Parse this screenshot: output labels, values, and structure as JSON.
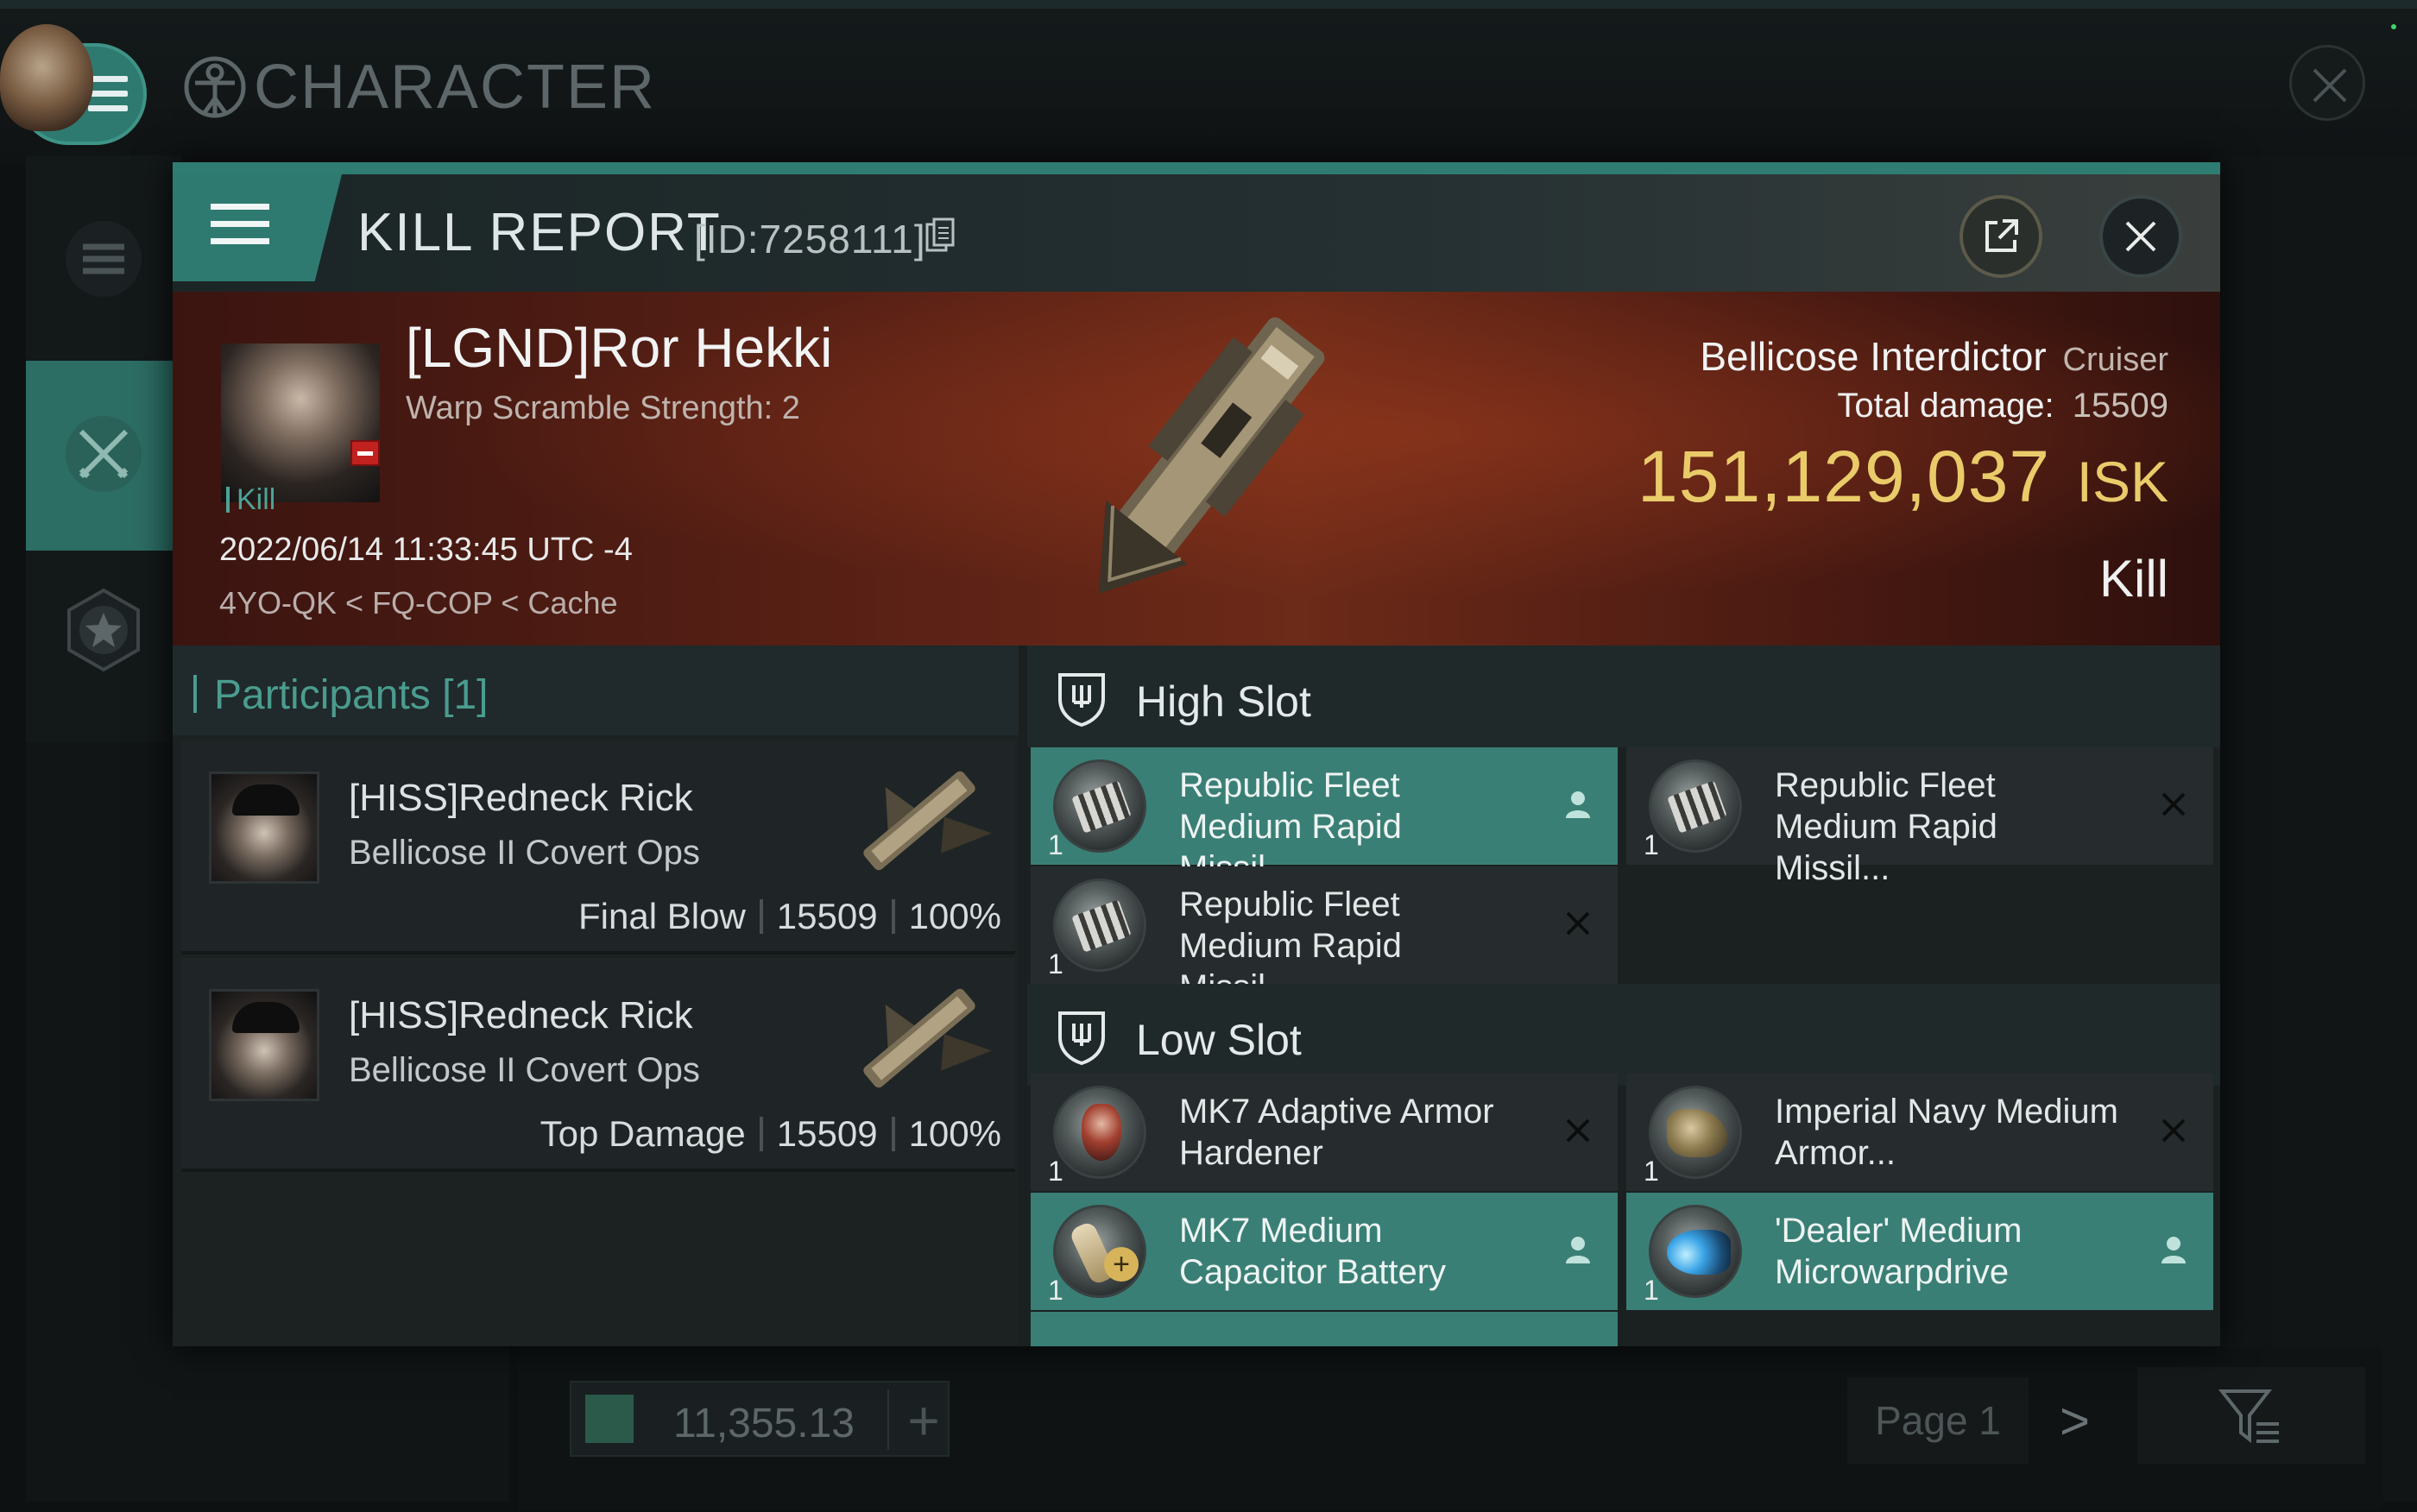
{
  "app": {
    "title": "CHARACTER"
  },
  "modal": {
    "title": "KILL REPORT",
    "id_label": "[ID:7258111]"
  },
  "victim": {
    "name": "[LGND]Ror Hekki",
    "subtitle": "Warp Scramble Strength: 2",
    "tag": "Kill",
    "datetime": "2022/06/14 11:33:45 UTC -4",
    "location": "4YO-QK < FQ-COP < Cache",
    "ship_name": "Bellicose Interdictor",
    "ship_class": "Cruiser",
    "total_damage_label": "Total damage:",
    "total_damage": "15509",
    "isk_value": "151,129,037",
    "isk_unit": "ISK",
    "result": "Kill"
  },
  "participants": {
    "header": "Participants [1]",
    "rows": [
      {
        "name": "[HISS]Redneck Rick",
        "ship": "Bellicose II Covert Ops",
        "role": "Final Blow",
        "damage": "15509",
        "percent": "100%"
      },
      {
        "name": "[HISS]Redneck Rick",
        "ship": "Bellicose II Covert Ops",
        "role": "Top Damage",
        "damage": "15509",
        "percent": "100%"
      }
    ]
  },
  "slots": {
    "high": {
      "label": "High Slot",
      "items": [
        {
          "name": "Republic Fleet Medium Rapid Missil...",
          "qty": "1",
          "state": "dropped",
          "icon": "missile-launcher-icon"
        },
        {
          "name": "Republic Fleet Medium Rapid Missil...",
          "qty": "1",
          "state": "destroyed",
          "icon": "missile-launcher-icon"
        },
        {
          "name": "Republic Fleet Medium Rapid Missil...",
          "qty": "1",
          "state": "destroyed",
          "icon": "missile-launcher-icon"
        }
      ]
    },
    "low": {
      "label": "Low Slot",
      "items": [
        {
          "name": "MK7 Adaptive Armor Hardener",
          "qty": "1",
          "state": "destroyed",
          "icon": "armor-hardener-icon"
        },
        {
          "name": "Imperial Navy Medium Armor...",
          "qty": "1",
          "state": "destroyed",
          "icon": "armor-repairer-icon"
        },
        {
          "name": "MK7 Medium Capacitor Battery",
          "qty": "1",
          "state": "dropped",
          "icon": "capacitor-battery-icon"
        },
        {
          "name": "'Dealer' Medium Microwarpdrive",
          "qty": "1",
          "state": "dropped",
          "icon": "microwarpdrive-icon"
        }
      ]
    }
  },
  "footer": {
    "wallet_amount": "11,355.13",
    "page_label": "Page 1"
  },
  "colors": {
    "accent_teal": "#3a7f75",
    "isk_gold": "#eacb6a",
    "banner_red": "#5a2115"
  }
}
